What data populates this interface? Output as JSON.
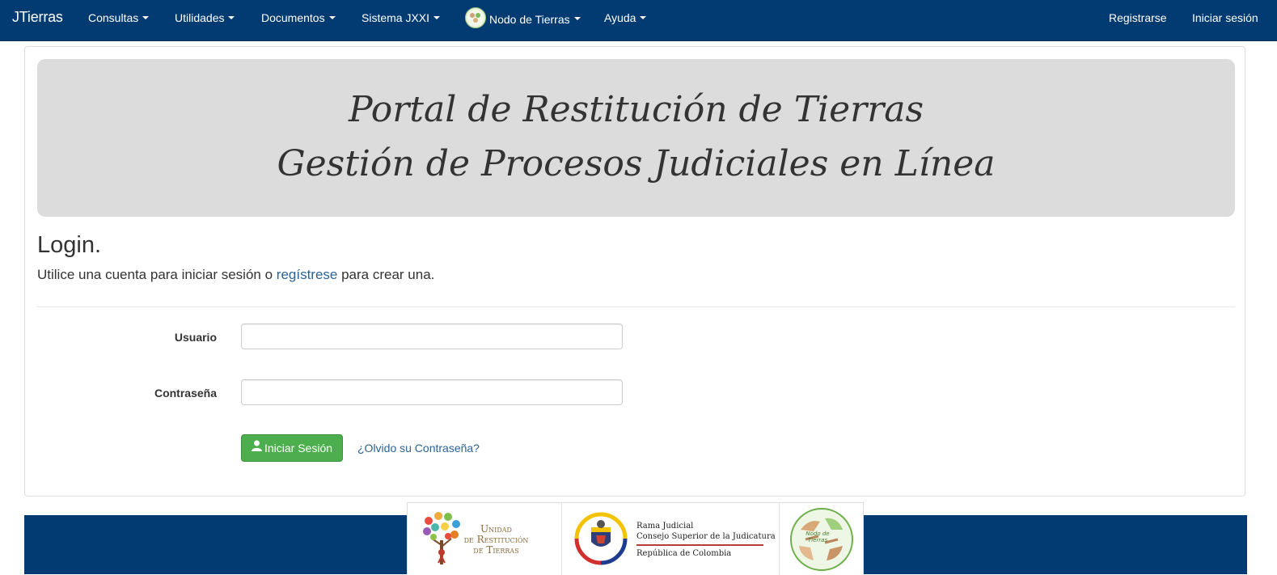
{
  "navbar": {
    "brand": "JTierras",
    "menus": [
      {
        "label": "Consultas"
      },
      {
        "label": "Utilidades"
      },
      {
        "label": "Documentos"
      },
      {
        "label": "Sistema JXXI"
      },
      {
        "label": "Nodo de Tierras"
      },
      {
        "label": "Ayuda"
      }
    ],
    "register": "Registrarse",
    "login": "Iniciar sesión",
    "background_color": "#023b72"
  },
  "banner": {
    "line1": "Portal de Restitución de Tierras",
    "line2": "Gestión de Procesos Judiciales en Línea"
  },
  "login": {
    "title": "Login.",
    "subtitle_prefix": "Utilice una cuenta para iniciar sesión o ",
    "subtitle_link": "regístrese",
    "subtitle_suffix": " para crear una.",
    "username_label": "Usuario",
    "username_value": "",
    "password_label": "Contraseña",
    "password_value": "",
    "submit_label": "Iniciar Sesión",
    "forgot_link": "¿Olvido su Contraseña?",
    "submit_color": "#4cae4c",
    "link_color": "#2a6496"
  },
  "footer": {
    "logo1": {
      "line1": "Unidad",
      "line2": "de Restitución",
      "line3": "de Tierras"
    },
    "logo2": {
      "line1": "Rama Judicial",
      "line2": "Consejo Superior de la Judicatura",
      "line3": "República de Colombia"
    },
    "logo3": {
      "text": "Nodo de Tierras"
    }
  }
}
